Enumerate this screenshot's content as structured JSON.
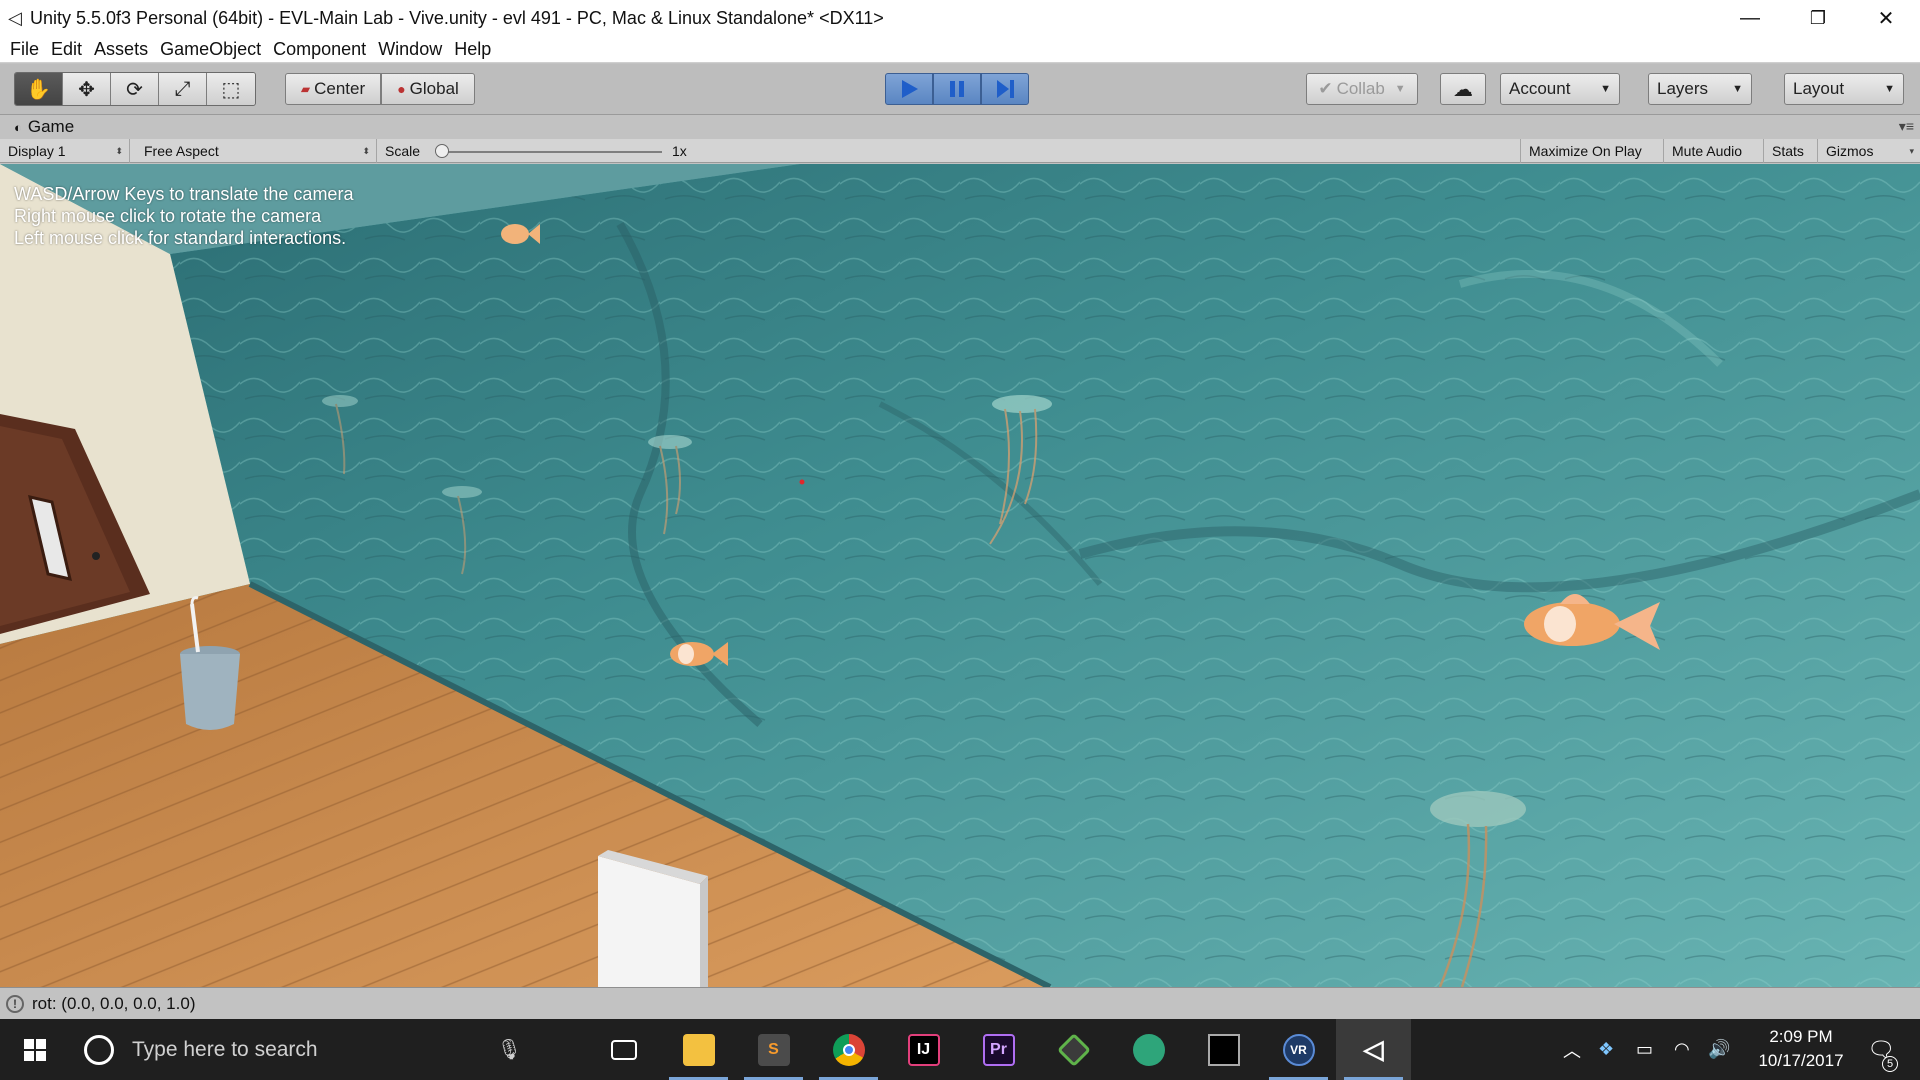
{
  "window": {
    "title": "Unity 5.5.0f3 Personal (64bit) - EVL-Main Lab - Vive.unity - evl 491 - PC, Mac & Linux Standalone* <DX11>",
    "controls": {
      "minimize": "—",
      "restore": "❐",
      "close": "✕"
    }
  },
  "menu": [
    "File",
    "Edit",
    "Assets",
    "GameObject",
    "Component",
    "Window",
    "Help"
  ],
  "toolbar": {
    "tools": [
      "hand-icon",
      "move-icon",
      "rotate-icon",
      "scale-icon",
      "rect-icon"
    ],
    "pivot_label": "Center",
    "space_label": "Global",
    "collab_label": "Collab",
    "account_label": "Account",
    "layers_label": "Layers",
    "layout_label": "Layout"
  },
  "game_tab": {
    "title": "Game"
  },
  "game_bar": {
    "display": "Display 1",
    "aspect": "Free Aspect",
    "scale_label": "Scale",
    "scale_value": "1x",
    "maximize": "Maximize On Play",
    "mute": "Mute Audio",
    "stats": "Stats",
    "gizmos": "Gizmos"
  },
  "hints": [
    "WASD/Arrow Keys to translate the camera",
    "Right mouse click to rotate the camera",
    "Left mouse click for standard interactions."
  ],
  "status": {
    "text": "rot: (0.0, 0.0, 0.0, 1.0)"
  },
  "taskbar": {
    "search_placeholder": "Type here to search",
    "time": "2:09 PM",
    "date": "10/17/2017",
    "notifications": "5",
    "apps": [
      {
        "name": "task-view",
        "label": ""
      },
      {
        "name": "file-explorer",
        "label": ""
      },
      {
        "name": "sublime-text",
        "label": "S"
      },
      {
        "name": "chrome",
        "label": ""
      },
      {
        "name": "intellij",
        "label": "IJ"
      },
      {
        "name": "premiere",
        "label": "Pr"
      },
      {
        "name": "git-client",
        "label": ""
      },
      {
        "name": "atom",
        "label": ""
      },
      {
        "name": "terminal",
        "label": ""
      },
      {
        "name": "steamvr",
        "label": "VR"
      },
      {
        "name": "unity",
        "label": ""
      }
    ]
  },
  "colors": {
    "water": "#4f9ea0",
    "floor": "#c98a4e",
    "wall": "#e8e2cf",
    "door": "#5a2e1e",
    "play_blue": "#5a86c2"
  }
}
